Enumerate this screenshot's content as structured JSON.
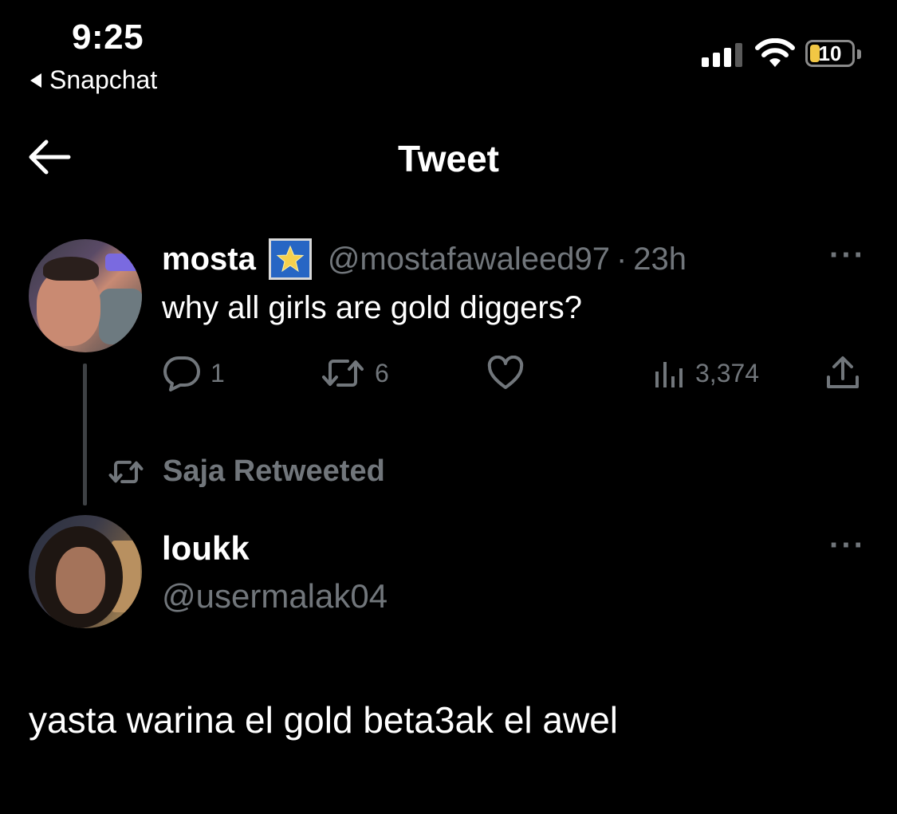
{
  "status_bar": {
    "time": "9:25",
    "back_app": "Snapchat",
    "battery_level": "10",
    "signal_bars_filled": 3,
    "signal_bars_total": 4
  },
  "header": {
    "title": "Tweet",
    "back_icon": "arrow-left-icon"
  },
  "original_tweet": {
    "display_name": "mosta",
    "badge_icon": "star-emoji-icon",
    "handle": "@mostafawaleed97",
    "separator": "·",
    "time_ago": "23h",
    "text": "why all girls are gold diggers?",
    "more_label": "···",
    "stats": {
      "replies": "1",
      "retweets": "6",
      "views": "3,374"
    }
  },
  "retweet_label": "Saja Retweeted",
  "reply_tweet": {
    "display_name": "loukk",
    "handle": "@usermalak04",
    "more_label": "···",
    "text": "yasta warina el gold beta3ak el awel"
  },
  "colors": {
    "background": "#000000",
    "primary_text": "#ffffff",
    "secondary_text": "#71767b",
    "battery_fill": "#f2c744"
  }
}
